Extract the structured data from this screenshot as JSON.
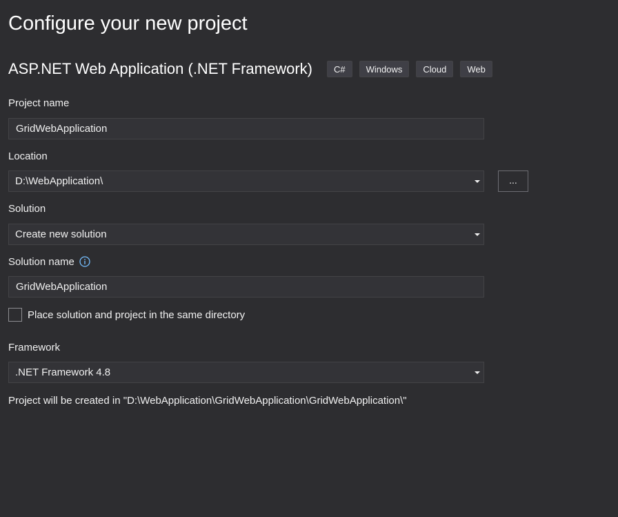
{
  "page": {
    "title": "Configure your new project"
  },
  "template": {
    "name": "ASP.NET Web Application (.NET Framework)",
    "tags": [
      "C#",
      "Windows",
      "Cloud",
      "Web"
    ]
  },
  "project_name": {
    "label": "Project name",
    "value": "GridWebApplication"
  },
  "location": {
    "label": "Location",
    "value": "D:\\WebApplication\\",
    "browse_label": "..."
  },
  "solution": {
    "label": "Solution",
    "value": "Create new solution"
  },
  "solution_name": {
    "label": "Solution name",
    "value": "GridWebApplication",
    "info_icon": "info-icon",
    "info_color": "#75beff"
  },
  "same_directory": {
    "label": "Place solution and project in the same directory",
    "checked": false
  },
  "framework": {
    "label": "Framework",
    "value": ".NET Framework 4.8"
  },
  "status": {
    "text": "Project will be created in \"D:\\WebApplication\\GridWebApplication\\GridWebApplication\\\""
  },
  "colors": {
    "background": "#2d2d30",
    "field_background": "#333337",
    "field_border": "#434346",
    "text": "#f1f1f1"
  }
}
